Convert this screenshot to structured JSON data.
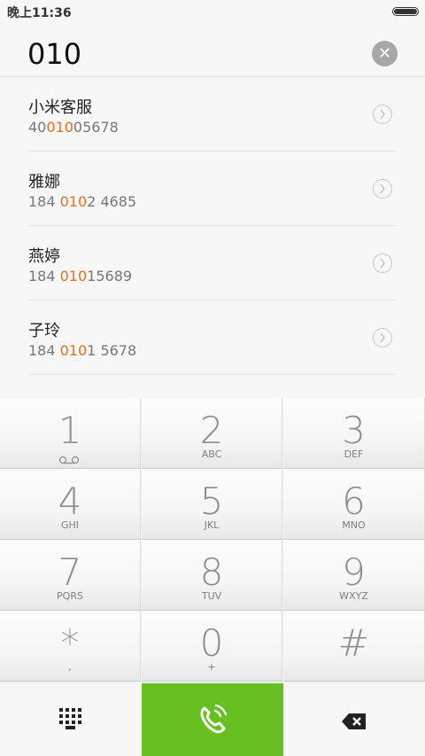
{
  "status": {
    "time": "晚上11:36"
  },
  "search": {
    "query": "010",
    "clear_icon": "close-icon"
  },
  "results": [
    {
      "name": "小米客服",
      "number_parts": [
        "40",
        "010",
        "05678"
      ]
    },
    {
      "name": "雅娜",
      "number_parts": [
        "184 ",
        "010",
        "2 4685"
      ]
    },
    {
      "name": "燕婷",
      "number_parts": [
        "184 ",
        "010",
        "15689"
      ]
    },
    {
      "name": "子玲",
      "number_parts": [
        "184 ",
        "010",
        "1 5678"
      ]
    }
  ],
  "dialpad": [
    {
      "num": "1",
      "letters": ""
    },
    {
      "num": "2",
      "letters": "ABC"
    },
    {
      "num": "3",
      "letters": "DEF"
    },
    {
      "num": "4",
      "letters": "GHI"
    },
    {
      "num": "5",
      "letters": "JKL"
    },
    {
      "num": "6",
      "letters": "MNO"
    },
    {
      "num": "7",
      "letters": "PQRS"
    },
    {
      "num": "8",
      "letters": "TUV"
    },
    {
      "num": "9",
      "letters": "WXYZ"
    },
    {
      "num": "*",
      "letters": ","
    },
    {
      "num": "0",
      "letters": "+"
    },
    {
      "num": "#",
      "letters": ""
    }
  ],
  "colors": {
    "accent_match": "#ef6f19",
    "call_green": "#68bf22"
  },
  "icons": {
    "voicemail": "voicemail-icon",
    "keypad": "keypad-icon",
    "call": "phone-call-icon",
    "delete": "backspace-icon"
  }
}
